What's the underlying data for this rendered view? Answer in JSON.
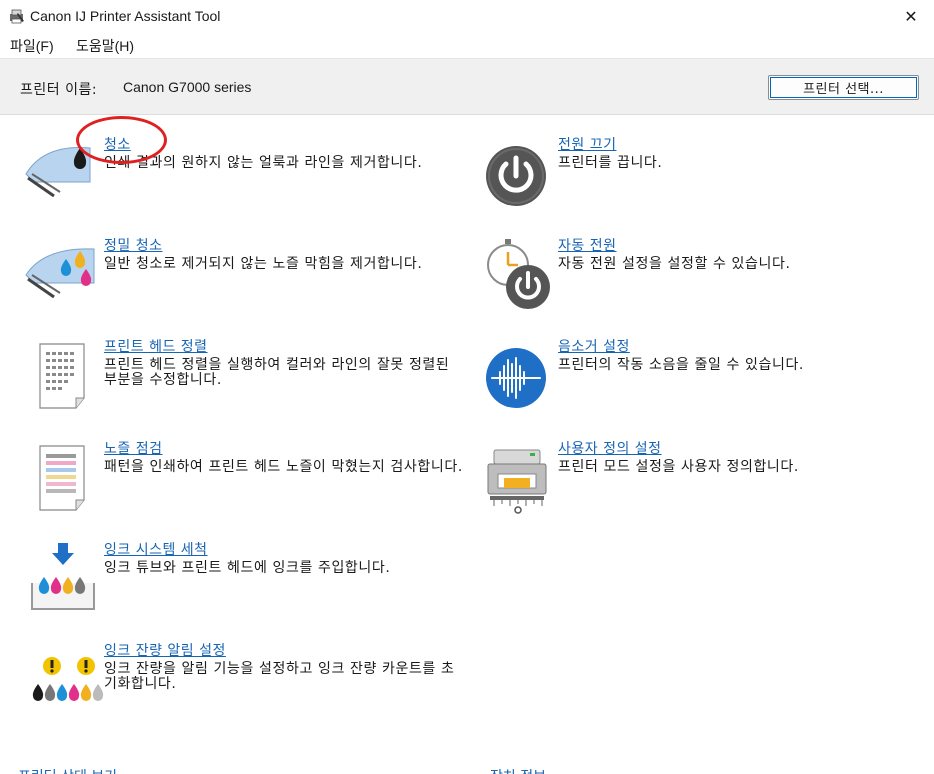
{
  "window": {
    "title": "Canon IJ Printer Assistant Tool",
    "close_glyph": "✕"
  },
  "menubar": {
    "items": [
      {
        "label": "파일(F)"
      },
      {
        "label": "도움말(H)"
      }
    ]
  },
  "printer": {
    "name_label": "프린터 이름:",
    "name_value": "Canon G7000 series",
    "select_button": "프린터 선택..."
  },
  "left_items": [
    {
      "title": "청소",
      "desc": "인쇄 결과의 원하지 않는 얼룩과 라인을 제거합니다.",
      "icon": "cleaning-icon"
    },
    {
      "title": "정밀 청소",
      "desc": "일반 청소로 제거되지 않는 노즐 막힘을 제거합니다.",
      "icon": "deep-cleaning-icon"
    },
    {
      "title": "프린트 헤드 정렬",
      "desc": "프린트 헤드 정렬을 실행하여 컬러와 라인의 잘못 정렬된 부분을 수정합니다.",
      "icon": "print-head-alignment-icon"
    },
    {
      "title": "노즐 점검",
      "desc": "패턴을 인쇄하여 프린트 헤드 노즐이 막혔는지 검사합니다.",
      "icon": "nozzle-check-icon"
    },
    {
      "title": "잉크 시스템 세척",
      "desc": "잉크 튜브와 프린트 헤드에 잉크를 주입합니다.",
      "icon": "ink-flush-icon"
    },
    {
      "title": "잉크 잔량 알림 설정",
      "desc": "잉크 잔량을 알림 기능을 설정하고 잉크 잔량 카운트를 초기화합니다.",
      "icon": "ink-level-notification-icon"
    }
  ],
  "right_items": [
    {
      "title": "전원 끄기",
      "desc": "프린터를 끕니다.",
      "icon": "power-off-icon"
    },
    {
      "title": "자동 전원",
      "desc": "자동 전원 설정을 설정할 수 있습니다.",
      "icon": "auto-power-icon"
    },
    {
      "title": "음소거 설정",
      "desc": "프린터의 작동 소음을 줄일 수 있습니다.",
      "icon": "quiet-setting-icon"
    },
    {
      "title": "사용자 정의 설정",
      "desc": "프린터 모드 설정을 사용자 정의합니다.",
      "icon": "custom-settings-icon"
    }
  ],
  "bottom_links": [
    {
      "label": "프린터 상태 보기"
    },
    {
      "label": "장치 정보"
    }
  ],
  "colors": {
    "link": "#1864b4",
    "highlight": "#e02020",
    "gray_icon": "#555555",
    "blue_icon": "#1f6fc6"
  }
}
